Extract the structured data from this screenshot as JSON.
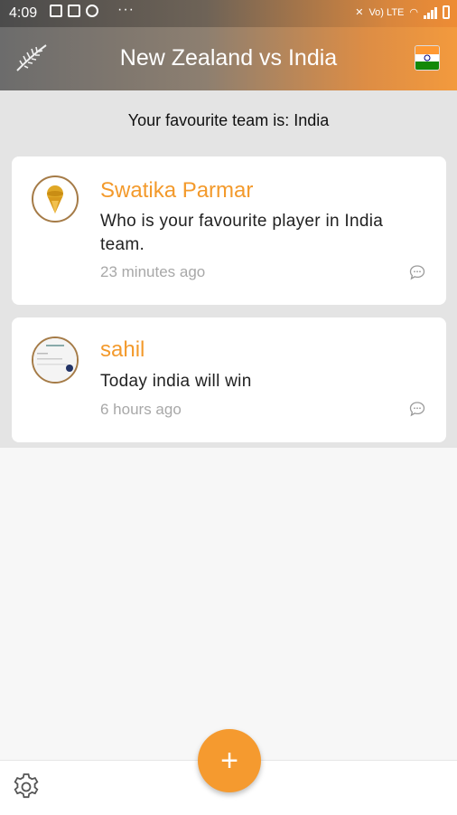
{
  "status_bar": {
    "time": "4:09",
    "dots": "···",
    "network_label": "Vo) LTE"
  },
  "app_bar": {
    "title": "New Zealand vs India",
    "left_icon": "fern-icon",
    "right_icon": "india-flag-icon"
  },
  "favourite": {
    "text": "Your favourite team is: India"
  },
  "posts": [
    {
      "username": "Swatika Parmar",
      "message": "Who is your favourite player in India team.",
      "time": "23 minutes ago",
      "avatar_icon": "trophy-avatar",
      "comment_icon": "comment-icon"
    },
    {
      "username": "sahil",
      "message": "Today india will win",
      "time": "6 hours ago",
      "avatar_icon": "screenshot-avatar",
      "comment_icon": "comment-icon"
    }
  ],
  "fab": {
    "label": "+"
  },
  "colors": {
    "accent": "#f39a2c",
    "fab": "#f59a2f"
  }
}
